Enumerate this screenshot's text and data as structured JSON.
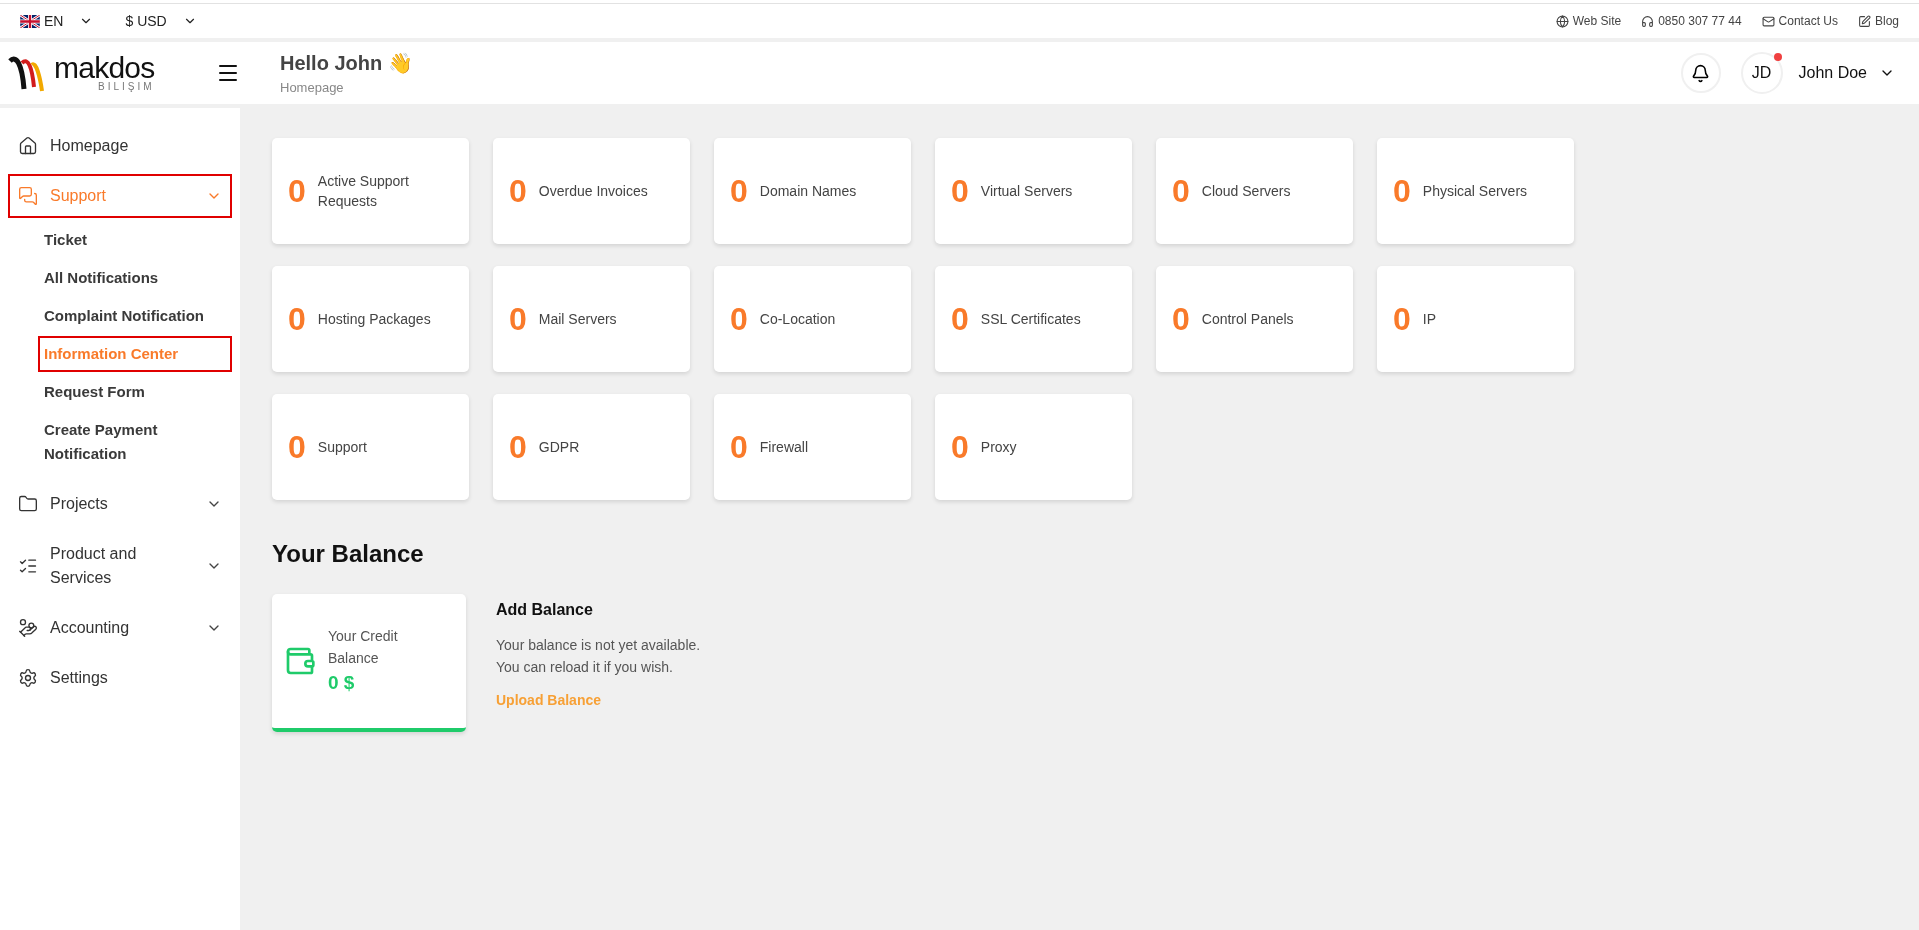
{
  "top_bar": {
    "language": "EN",
    "currency": "$ USD",
    "links": [
      {
        "label": "Web Site"
      },
      {
        "label": "0850 307 77 44"
      },
      {
        "label": "Contact Us"
      },
      {
        "label": "Blog"
      }
    ]
  },
  "header": {
    "logo": {
      "name": "makdos",
      "tagline": "BILIŞIM"
    },
    "greeting": "Hello John 👋",
    "breadcrumb": "Homepage",
    "avatar_initials": "JD",
    "has_notification": true,
    "user_name": "John Doe"
  },
  "sidebar": {
    "items": [
      {
        "label": "Homepage",
        "kind": "link",
        "selected": false,
        "highlighted": false
      },
      {
        "label": "Support",
        "kind": "group",
        "selected": true,
        "expanded": true,
        "highlighted": true,
        "children": [
          {
            "label": "Ticket",
            "selected": false,
            "highlighted": false
          },
          {
            "label": "All Notifications",
            "selected": false,
            "highlighted": false
          },
          {
            "label": "Complaint Notification",
            "selected": false,
            "highlighted": false
          },
          {
            "label": "Information Center",
            "selected": true,
            "highlighted": true
          },
          {
            "label": "Request Form",
            "selected": false,
            "highlighted": false
          },
          {
            "label": "Create Payment Notification",
            "selected": false,
            "highlighted": false
          }
        ]
      },
      {
        "label": "Projects",
        "kind": "group",
        "selected": false,
        "expanded": false,
        "highlighted": false
      },
      {
        "label": "Product and Services",
        "kind": "group",
        "selected": false,
        "expanded": false,
        "highlighted": false
      },
      {
        "label": "Accounting",
        "kind": "group",
        "selected": false,
        "expanded": false,
        "highlighted": false
      },
      {
        "label": "Settings",
        "kind": "link",
        "selected": false,
        "highlighted": false
      }
    ]
  },
  "stats": [
    {
      "count": "0",
      "label": "Active Support Requests"
    },
    {
      "count": "0",
      "label": "Overdue Invoices"
    },
    {
      "count": "0",
      "label": "Domain Names"
    },
    {
      "count": "0",
      "label": "Virtual Servers"
    },
    {
      "count": "0",
      "label": "Cloud Servers"
    },
    {
      "count": "0",
      "label": "Physical Servers"
    },
    {
      "count": "0",
      "label": "Hosting Packages"
    },
    {
      "count": "0",
      "label": "Mail Servers"
    },
    {
      "count": "0",
      "label": "Co-Location"
    },
    {
      "count": "0",
      "label": "SSL Certificates"
    },
    {
      "count": "0",
      "label": "Control Panels"
    },
    {
      "count": "0",
      "label": "IP"
    },
    {
      "count": "0",
      "label": "Support"
    },
    {
      "count": "0",
      "label": "GDPR"
    },
    {
      "count": "0",
      "label": "Firewall"
    },
    {
      "count": "0",
      "label": "Proxy"
    }
  ],
  "balance": {
    "title": "Your Balance",
    "card_label": "Your Credit Balance",
    "amount": "0 $",
    "add_title": "Add Balance",
    "add_lines": [
      "Your balance is not yet available.",
      "You can reload it if you wish."
    ],
    "upload_link": "Upload Balance"
  }
}
